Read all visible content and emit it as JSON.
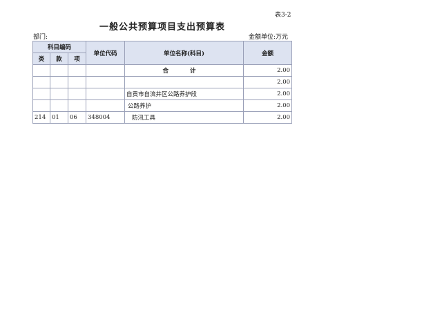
{
  "header": {
    "table_no": "表3-2",
    "title": "一般公共预算项目支出预算表",
    "department": "部门:",
    "unit": "金额单位:万元"
  },
  "columns": {
    "subject_code": "科目编码",
    "lei": "类",
    "kuan": "款",
    "xiang": "项",
    "unit_code": "单位代码",
    "unit_name": "单位名称(科目)",
    "amount": "金额"
  },
  "rows": [
    {
      "lei": "",
      "kuan": "",
      "xiang": "",
      "code": "",
      "name": "合  计",
      "amount": "2.00"
    },
    {
      "lei": "",
      "kuan": "",
      "xiang": "",
      "code": "",
      "name": "",
      "amount": "2.00"
    },
    {
      "lei": "",
      "kuan": "",
      "xiang": "",
      "code": "",
      "name": "自贡市自流井区公路养护段",
      "amount": "2.00"
    },
    {
      "lei": "",
      "kuan": "",
      "xiang": "",
      "code": "",
      "name": "公路养护",
      "amount": "2.00"
    },
    {
      "lei": "214",
      "kuan": "01",
      "xiang": "06",
      "code": "348004",
      "name": "防汛工具",
      "amount": "2.00"
    }
  ]
}
